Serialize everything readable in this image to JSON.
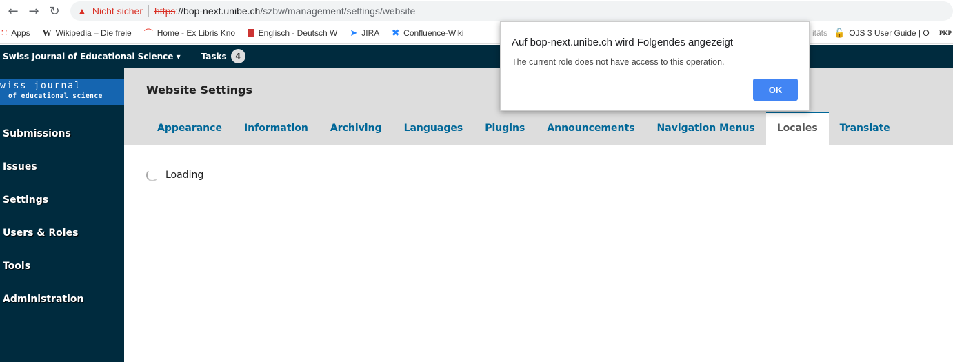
{
  "browser": {
    "insecure_label": "Nicht sicher",
    "url_scheme": "https",
    "url_host": "://bop-next.unibe.ch",
    "url_path": "/szbw/management/settings/website"
  },
  "bookmarks": [
    {
      "icon": "apps-grid-icon",
      "label": "Apps"
    },
    {
      "icon": "wikipedia-icon",
      "label": "Wikipedia – Die freie"
    },
    {
      "icon": "ex-libris-icon",
      "label": "Home - Ex Libris Kno"
    },
    {
      "icon": "leo-icon",
      "label": "Englisch - Deutsch W"
    },
    {
      "icon": "jira-icon",
      "label": "JIRA"
    },
    {
      "icon": "confluence-icon",
      "label": "Confluence-Wiki"
    },
    {
      "icon": "page-icon",
      "label": "itäts"
    },
    {
      "icon": "lock-open-icon",
      "label": "OJS 3 User Guide | O"
    },
    {
      "icon": "pkp-icon",
      "label": "PKP"
    }
  ],
  "topbar": {
    "context": "Swiss Journal of Educational Science",
    "tasks_label": "Tasks",
    "tasks_count": "4"
  },
  "logo": {
    "line1": "wiss journal",
    "line2": "of educational science"
  },
  "sidebar": {
    "items": [
      "Submissions",
      "Issues",
      "Settings",
      "Users & Roles",
      "Tools",
      "Administration"
    ]
  },
  "page": {
    "title": "Website Settings",
    "tabs": [
      "Appearance",
      "Information",
      "Archiving",
      "Languages",
      "Plugins",
      "Announcements",
      "Navigation Menus",
      "Locales",
      "Translate"
    ],
    "active_tab": "Locales",
    "loading": "Loading"
  },
  "dialog": {
    "title": "Auf bop-next.unibe.ch wird Folgendes angezeigt",
    "message": "The current role does not have access to this operation.",
    "ok": "OK"
  }
}
